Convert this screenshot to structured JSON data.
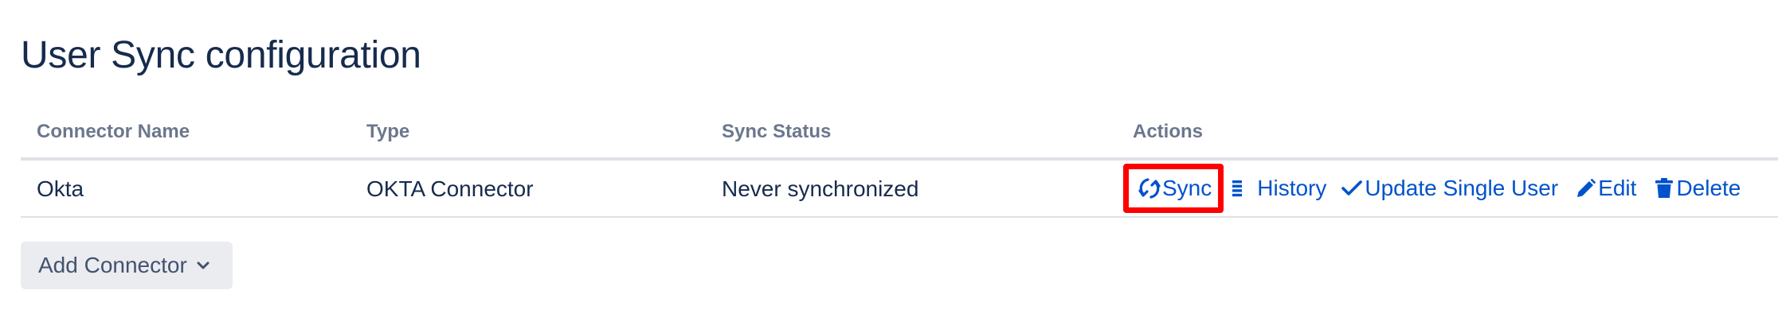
{
  "page": {
    "title": "User Sync configuration"
  },
  "table": {
    "headers": [
      "Connector Name",
      "Type",
      "Sync Status",
      "Actions"
    ],
    "rows": [
      {
        "name": "Okta",
        "type": "OKTA Connector",
        "status": "Never synchronized",
        "actions": {
          "sync": "Sync",
          "history": "History",
          "update_single_user": "Update Single User",
          "edit": "Edit",
          "delete": "Delete"
        }
      }
    ]
  },
  "buttons": {
    "add_connector": "Add Connector"
  },
  "icons": {
    "sync": "sync-icon",
    "history": "list-icon",
    "update_single_user": "check-icon",
    "edit": "pencil-icon",
    "delete": "trash-icon",
    "add_connector": "chevron-down-icon"
  },
  "colors": {
    "link": "#0052cc",
    "heading": "#172b4d",
    "header_text": "#6b778c",
    "highlight": "#ff0000",
    "button_bg": "#ebecf0"
  }
}
